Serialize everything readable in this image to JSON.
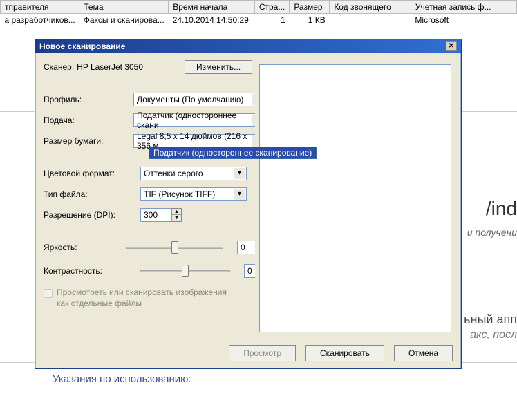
{
  "bg_table": {
    "headers": {
      "sender": "тправителя",
      "subject": "Тема",
      "time": "Время начала",
      "pages": "Стра...",
      "size": "Размер",
      "caller": "Код звонящего",
      "account": "Учетная запись ф..."
    },
    "row": {
      "sender": "а разработчиков...",
      "subject": "Факсы и сканирова...",
      "time": "24.10.2014 14:50:29",
      "pages": "1",
      "size": "1 КВ",
      "caller": "",
      "account": "Microsoft"
    }
  },
  "bg": {
    "big": "/ind",
    "sub": "и получени",
    "line1": "ьный апп",
    "line2": "акс, посл",
    "help": "Указания по использованию:"
  },
  "dialog": {
    "title": "Новое сканирование",
    "scanner_label": "Сканер:",
    "scanner_name": "HP LaserJet 3050",
    "change_btn": "Изменить...",
    "profile_label": "Профиль:",
    "profile_value": "Документы (По умолчанию)",
    "feed_label": "Подача:",
    "feed_value": "Податчик (одностороннее скани",
    "feed_option": "Податчик (одностороннее сканирование)",
    "paper_label": "Размер бумаги:",
    "paper_value": "Legal 8,5 x 14 дюймов (216 x 356 м",
    "color_label": "Цветовой формат:",
    "color_value": "Оттенки серого",
    "file_label": "Тип файла:",
    "file_value": "TIF (Рисунок TIFF)",
    "dpi_label": "Разрешение (DPI):",
    "dpi_value": "300",
    "brightness_label": "Яркость:",
    "brightness_value": "0",
    "contrast_label": "Контрастность:",
    "contrast_value": "0",
    "preview_checkbox": "Просмотреть или сканировать изображения как отдельные файлы",
    "btn_preview": "Просмотр",
    "btn_scan": "Сканировать",
    "btn_cancel": "Отмена"
  }
}
